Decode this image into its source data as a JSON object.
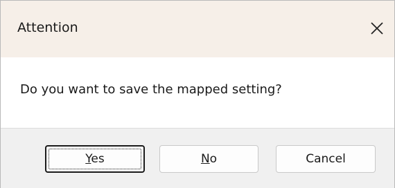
{
  "dialog": {
    "title": "Attention",
    "close_icon": "close-icon",
    "message": "Do you want to save the mapped setting?",
    "buttons": {
      "yes": {
        "mnemonic": "Y",
        "rest": "es",
        "focused": true
      },
      "no": {
        "mnemonic": "N",
        "rest": "o"
      },
      "cancel": {
        "label": "Cancel"
      }
    }
  },
  "colors": {
    "titlebar_bg": "#f6efe8",
    "footer_bg": "#f0f0f0",
    "button_bg": "#fdfdfd"
  }
}
